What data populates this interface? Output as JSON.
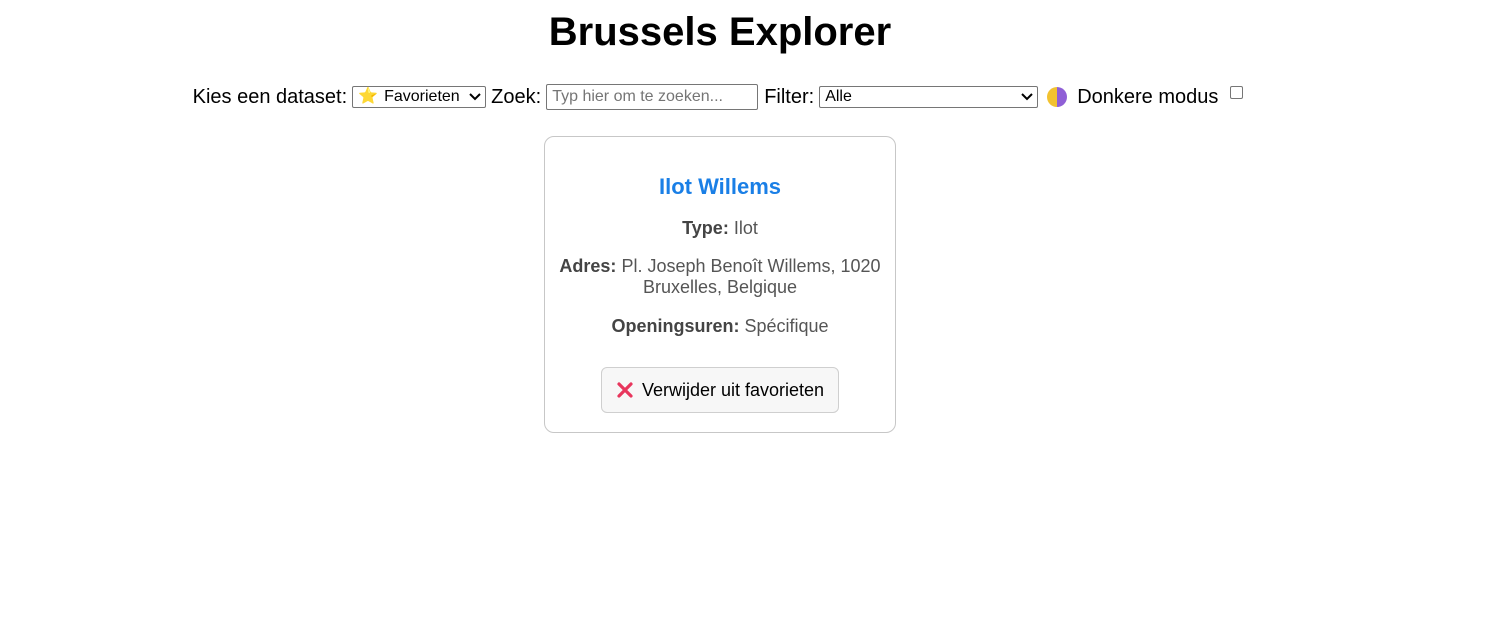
{
  "header": {
    "title": "Brussels Explorer"
  },
  "controls": {
    "dataset_label": "Kies een dataset:",
    "dataset_selected": "Favorieten",
    "dataset_icon": "star-icon",
    "search_label": "Zoek:",
    "search_placeholder": "Typ hier om te zoeken...",
    "search_value": "",
    "filter_label": "Filter:",
    "filter_selected": "Alle",
    "theme_icon": "half-moon-icon",
    "dark_mode_label": "Donkere modus",
    "dark_mode_checked": false
  },
  "card": {
    "title": "Ilot Willems",
    "type_label": "Type:",
    "type_value": "Ilot",
    "address_label": "Adres:",
    "address_value": "Pl. Joseph Benoît Willems, 1020 Bruxelles, Belgique",
    "hours_label": "Openingsuren:",
    "hours_value": "Spécifique",
    "remove_button_label": "Verwijder uit favorieten",
    "remove_icon": "cross-icon"
  },
  "colors": {
    "title_blue": "#1a7fe6",
    "remove_icon_red": "#e8365d",
    "theme_icon_yellow": "#f2c230",
    "theme_icon_purple": "#8f5fd6"
  }
}
